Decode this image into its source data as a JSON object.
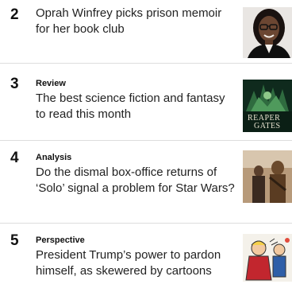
{
  "articles": [
    {
      "number": "2",
      "label": "",
      "headline": "Oprah Winfrey picks prison memoir for her book club",
      "thumbnail_icon": "oprah-photo"
    },
    {
      "number": "3",
      "label": "Review",
      "headline": "The best science fiction and fantasy to read this month",
      "thumbnail_icon": "book-cover-reaper-gates",
      "thumbnail_text_line1": "REAPER",
      "thumbnail_text_line2": "GATES"
    },
    {
      "number": "4",
      "label": "Analysis",
      "headline": "Do the dismal box-office returns of ‘Solo’ signal a problem for Star Wars?",
      "thumbnail_icon": "solo-movie-still"
    },
    {
      "number": "5",
      "label": "Perspective",
      "headline": "President Trump’s power to pardon himself, as skewered by cartoons",
      "thumbnail_icon": "political-cartoon"
    }
  ],
  "colors": {
    "text": "#222222",
    "number": "#111111",
    "divider": "#dddddd"
  }
}
